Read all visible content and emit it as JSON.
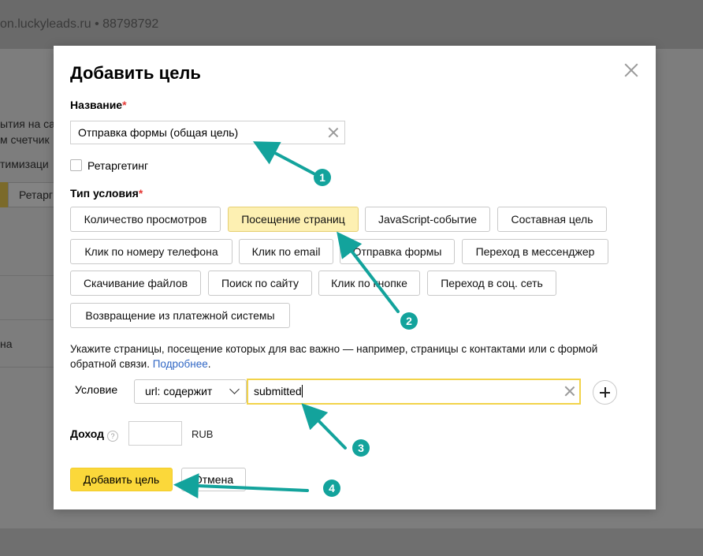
{
  "background": {
    "site": "on.luckyleads.ru • 88798792",
    "fragments": [
      "ытия на са",
      "м счетчик",
      "тимизаци",
      "Ретарг",
      "на"
    ]
  },
  "modal": {
    "title": "Добавить цель",
    "name_label": "Название",
    "required_mark": "*",
    "name_value": "Отправка формы (общая цель)",
    "retargeting_label": "Ретаргетинг",
    "retargeting_checked": false,
    "condition_type_label": "Тип условия",
    "condition_types": [
      "Количество просмотров",
      "Посещение страниц",
      "JavaScript-событие",
      "Составная цель",
      "Клик по номеру телефона",
      "Клик по email",
      "Отправка формы",
      "Переход в мессенджер",
      "Скачивание файлов",
      "Поиск по сайту",
      "Клик по кнопке",
      "Переход в соц. сеть",
      "Возвращение из платежной системы"
    ],
    "selected_condition_type": "Посещение страниц",
    "hint_text": "Укажите страницы, посещение которых для вас важно — например, страницы с контактами или с формой обратной связи. ",
    "hint_link": "Подробнее",
    "hint_end": ".",
    "condition_label": "Условие",
    "condition_operator": "url: содержит",
    "condition_value": "submitted",
    "income_label": "Доход",
    "help_icon_glyph": "?",
    "income_value": "",
    "currency": "RUB",
    "add_button": "Добавить цель",
    "cancel_button": "Отмена"
  },
  "annotations": [
    "1",
    "2",
    "3",
    "4"
  ],
  "colors": {
    "accent_yellow": "#fbd83a",
    "selected_chip": "#fdf0b2",
    "annotation_teal": "#13a39c",
    "link_blue": "#2f66c4",
    "required_red": "#e53935"
  }
}
